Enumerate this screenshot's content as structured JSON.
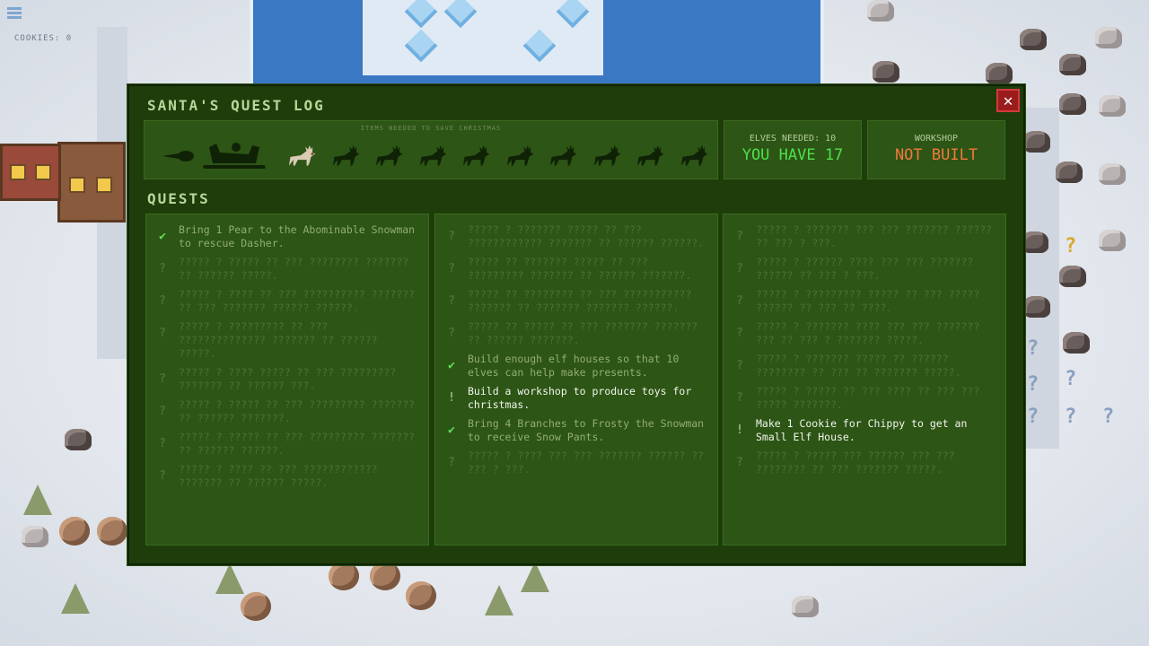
{
  "hud": {
    "cookies_label": "COOKIES: 0"
  },
  "quest_log": {
    "title": "SANTA'S QUEST LOG",
    "items_title": "ITEMS NEEDED TO SAVE CHRISTMAS",
    "items": [
      {
        "name": "rudolph-nose-icon",
        "collected": false
      },
      {
        "name": "sleigh-icon",
        "collected": false
      },
      {
        "name": "reindeer-dasher-icon",
        "collected": true
      },
      {
        "name": "reindeer-icon",
        "collected": false
      },
      {
        "name": "reindeer-icon",
        "collected": false
      },
      {
        "name": "reindeer-icon",
        "collected": false
      },
      {
        "name": "reindeer-icon",
        "collected": false
      },
      {
        "name": "reindeer-icon",
        "collected": false
      },
      {
        "name": "reindeer-icon",
        "collected": false
      },
      {
        "name": "reindeer-icon",
        "collected": false
      },
      {
        "name": "reindeer-icon",
        "collected": false
      },
      {
        "name": "reindeer-icon",
        "collected": false
      }
    ],
    "elves": {
      "label": "ELVES NEEDED: 10",
      "value": "YOU HAVE 17"
    },
    "workshop": {
      "label": "WORKSHOP",
      "value": "NOT BUILT"
    },
    "quests_title": "QUESTS",
    "columns": [
      [
        {
          "status": "done",
          "icon": "✔",
          "text": "Bring 1 Pear to the Abominable Snowman to rescue Dasher."
        },
        {
          "status": "locked",
          "icon": "?",
          "text": "????? ? ????? ?? ??? ???????? ??????? ?? ?????? ?????."
        },
        {
          "status": "locked",
          "icon": "?",
          "text": "????? ? ???? ?? ??? ?????????? ??????? ?? ??? ??????? ?????? ??????."
        },
        {
          "status": "locked",
          "icon": "?",
          "text": "????? ? ????????? ?? ??? ?????????????? ??????? ?? ?????? ?????."
        },
        {
          "status": "locked",
          "icon": "?",
          "text": "????? ? ???? ????? ?? ??? ????????? ??????? ?? ?????? ???."
        },
        {
          "status": "locked",
          "icon": "?",
          "text": "????? ? ????? ?? ??? ????????? ??????? ?? ?????? ???????."
        },
        {
          "status": "locked",
          "icon": "?",
          "text": "????? ? ????? ?? ??? ????????? ??????? ?? ?????? ??????."
        },
        {
          "status": "locked",
          "icon": "?",
          "text": "????? ? ???? ?? ??? ???????????? ??????? ?? ?????? ?????."
        }
      ],
      [
        {
          "status": "locked",
          "icon": "?",
          "text": "????? ? ??????? ????? ?? ??? ???????????? ??????? ?? ?????? ??????."
        },
        {
          "status": "locked",
          "icon": "?",
          "text": "????? ?? ??????? ????? ?? ??? ????????? ??????? ?? ?????? ???????."
        },
        {
          "status": "locked",
          "icon": "?",
          "text": "????? ?? ???????? ?? ??? ??????????? ??????? ?? ??????? ??????? ??????."
        },
        {
          "status": "locked",
          "icon": "?",
          "text": "????? ?? ????? ?? ??? ??????? ??????? ?? ?????? ???????."
        },
        {
          "status": "done",
          "icon": "✔",
          "text": "Build enough elf houses so that 10 elves can help make presents."
        },
        {
          "status": "active",
          "icon": "!",
          "text": "Build a workshop to produce toys for christmas."
        },
        {
          "status": "done",
          "icon": "✔",
          "text": "Bring 4 Branches to Frosty the Snowman to receive Snow Pants."
        },
        {
          "status": "locked",
          "icon": "?",
          "text": "????? ? ???? ??? ??? ??????? ?????? ?? ??? ? ???."
        }
      ],
      [
        {
          "status": "locked",
          "icon": "?",
          "text": "????? ? ??????? ??? ??? ??????? ?????? ?? ??? ? ???."
        },
        {
          "status": "locked",
          "icon": "?",
          "text": "????? ? ?????? ???? ??? ??? ??????? ?????? ?? ??? ? ???."
        },
        {
          "status": "locked",
          "icon": "?",
          "text": "????? ? ????????? ????? ?? ??? ????? ?????? ?? ??? ?? ????."
        },
        {
          "status": "locked",
          "icon": "?",
          "text": "????? ? ??????? ???? ??? ??? ??????? ??? ?? ??? ? ??????? ?????."
        },
        {
          "status": "locked",
          "icon": "?",
          "text": "????? ? ??????? ????? ?? ?????? ???????? ?? ??? ?? ??????? ?????."
        },
        {
          "status": "locked",
          "icon": "?",
          "text": "????? ? ????? ?? ??? ???? ?? ??? ??? ????? ???????."
        },
        {
          "status": "active",
          "icon": "!",
          "text": "Make 1 Cookie for Chippy to get an Small Elf House."
        },
        {
          "status": "locked",
          "icon": "?",
          "text": "????? ? ????? ??? ?????? ??? ??? ???????? ?? ??? ??????? ?????."
        }
      ]
    ]
  }
}
